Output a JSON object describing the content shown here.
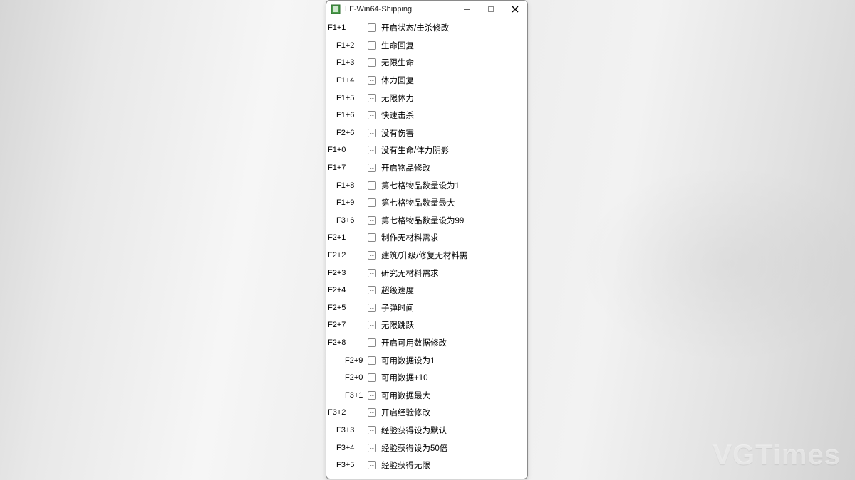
{
  "window": {
    "title": "LF-Win64-Shipping"
  },
  "watermark": "VGTimes",
  "rows": [
    {
      "hotkey": "F1+1",
      "indent": 0,
      "label": "开启状态/击杀修改"
    },
    {
      "hotkey": "F1+2",
      "indent": 1,
      "label": "生命回复"
    },
    {
      "hotkey": "F1+3",
      "indent": 1,
      "label": "无限生命"
    },
    {
      "hotkey": "F1+4",
      "indent": 1,
      "label": "体力回复"
    },
    {
      "hotkey": "F1+5",
      "indent": 1,
      "label": "无限体力"
    },
    {
      "hotkey": "F1+6",
      "indent": 1,
      "label": "快速击杀"
    },
    {
      "hotkey": "F2+6",
      "indent": 1,
      "label": "没有伤害"
    },
    {
      "hotkey": "F1+0",
      "indent": 0,
      "label": "没有生命/体力阴影"
    },
    {
      "hotkey": "F1+7",
      "indent": 0,
      "label": "开启物品修改"
    },
    {
      "hotkey": "F1+8",
      "indent": 1,
      "label": "第七格物品数量设为1"
    },
    {
      "hotkey": "F1+9",
      "indent": 1,
      "label": "第七格物品数量最大"
    },
    {
      "hotkey": "F3+6",
      "indent": 1,
      "label": "第七格物品数量设为99"
    },
    {
      "hotkey": "F2+1",
      "indent": 0,
      "label": "制作无材料需求"
    },
    {
      "hotkey": "F2+2",
      "indent": 0,
      "label": "建筑/升级/修复无材料需"
    },
    {
      "hotkey": "F2+3",
      "indent": 0,
      "label": "研究无材料需求"
    },
    {
      "hotkey": "F2+4",
      "indent": 0,
      "label": "超级速度"
    },
    {
      "hotkey": "F2+5",
      "indent": 0,
      "label": "子弹时间"
    },
    {
      "hotkey": "F2+7",
      "indent": 0,
      "label": "无限跳跃"
    },
    {
      "hotkey": "F2+8",
      "indent": 0,
      "label": "开启可用数据修改"
    },
    {
      "hotkey": "F2+9",
      "indent": 2,
      "label": "可用数据设为1"
    },
    {
      "hotkey": "F2+0",
      "indent": 2,
      "label": "可用数据+10"
    },
    {
      "hotkey": "F3+1",
      "indent": 2,
      "label": "可用数据最大"
    },
    {
      "hotkey": "F3+2",
      "indent": 0,
      "label": "开启经验修改"
    },
    {
      "hotkey": "F3+3",
      "indent": 1,
      "label": "经验获得设为默认"
    },
    {
      "hotkey": "F3+4",
      "indent": 1,
      "label": "经验获得设为50倍"
    },
    {
      "hotkey": "F3+5",
      "indent": 1,
      "label": "经验获得无限"
    }
  ]
}
